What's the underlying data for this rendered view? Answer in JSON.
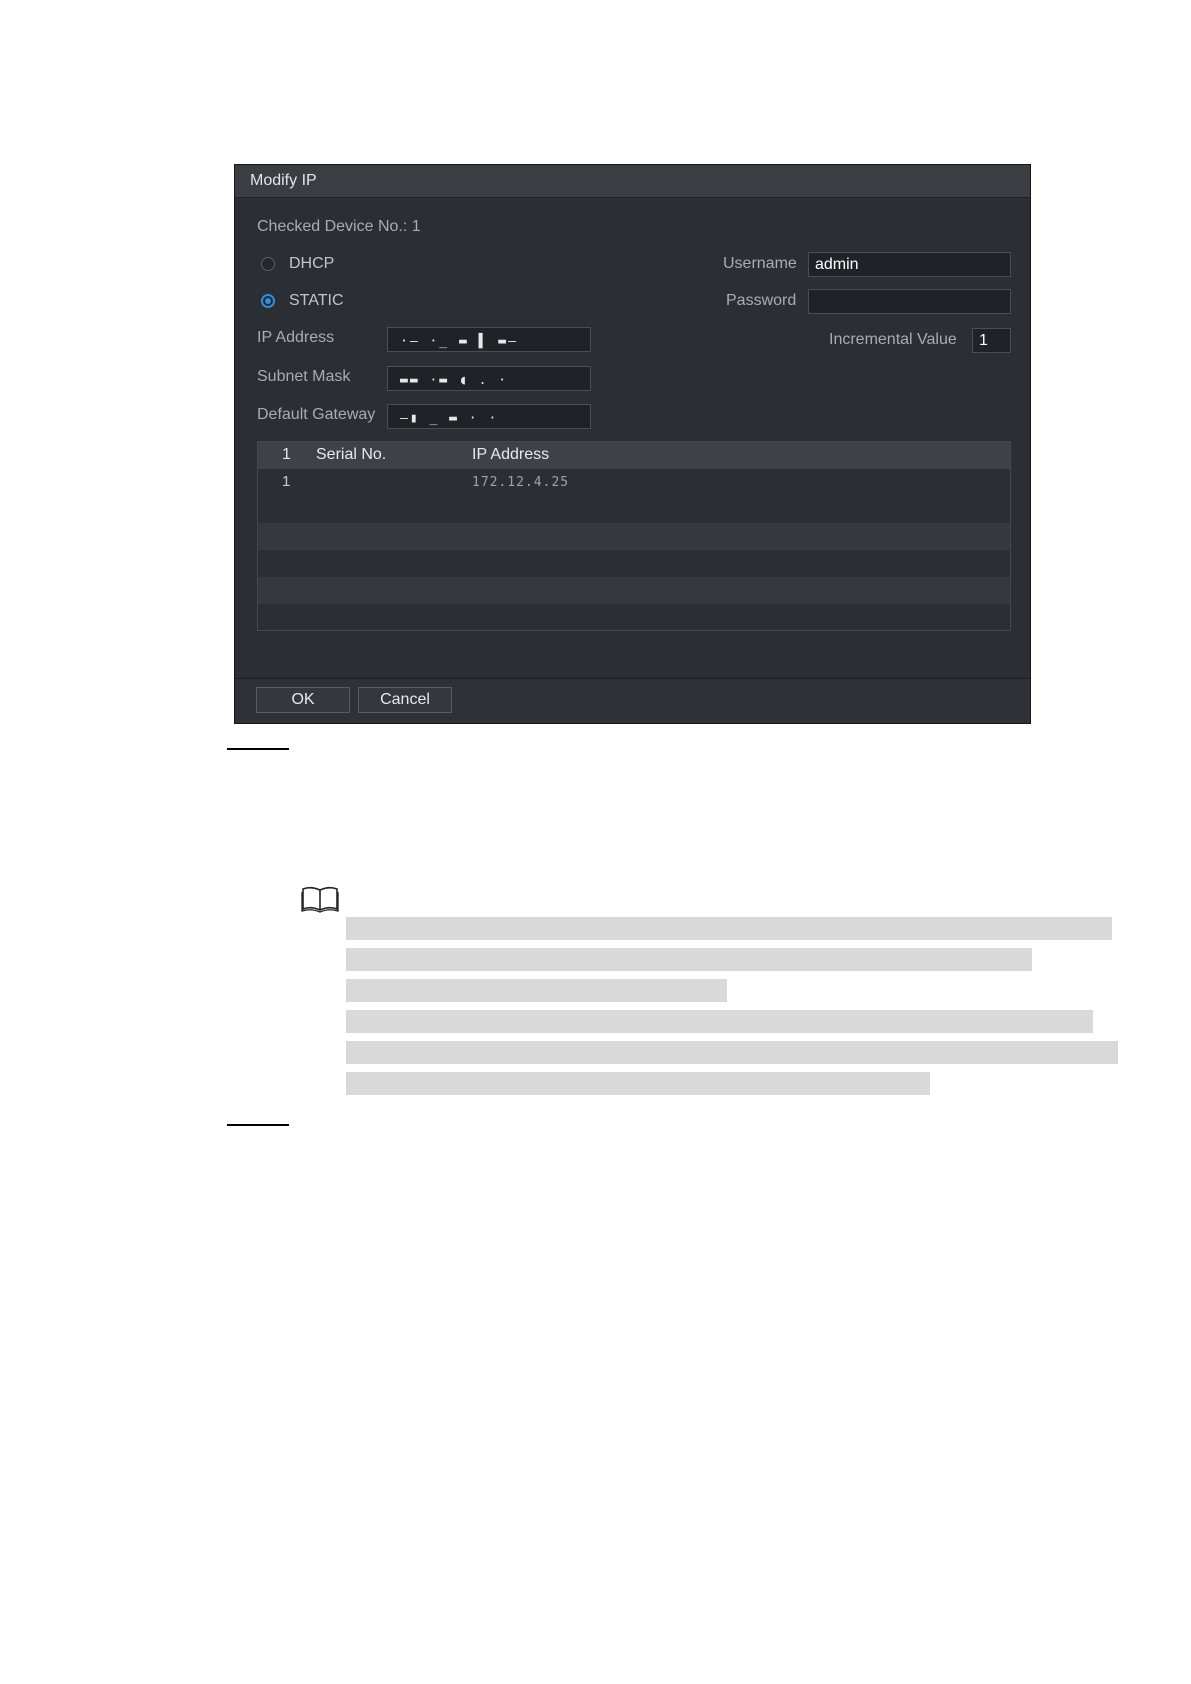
{
  "dialog": {
    "title": "Modify IP",
    "checked_device": "Checked Device No.: 1",
    "mode_options": [
      {
        "label": "DHCP",
        "selected": false
      },
      {
        "label": "STATIC",
        "selected": true
      }
    ],
    "fields": {
      "ip_address_label": "IP Address",
      "ip_address_value": "·– ·_ ▬ ▌ ▬–",
      "subnet_mask_label": "Subnet Mask",
      "subnet_mask_value": "▬▬ ·▬ ◖ . ·",
      "default_gateway_label": "Default Gateway",
      "default_gateway_value": "–▮ _ ▬ · ·",
      "username_label": "Username",
      "username_value": "admin",
      "password_label": "Password",
      "password_value": "",
      "incremental_label": "Incremental Value",
      "incremental_value": "1"
    },
    "table": {
      "headers": [
        "1",
        "Serial No.",
        "IP Address"
      ],
      "rows": [
        {
          "index": "1",
          "serial": "",
          "ip": "172.12.4.25"
        }
      ]
    },
    "buttons": {
      "ok": "OK",
      "cancel": "Cancel"
    },
    "colors": {
      "accent": "#2f8fe0",
      "background": "#2b2e33"
    }
  },
  "note": {
    "icon": "book-icon"
  }
}
